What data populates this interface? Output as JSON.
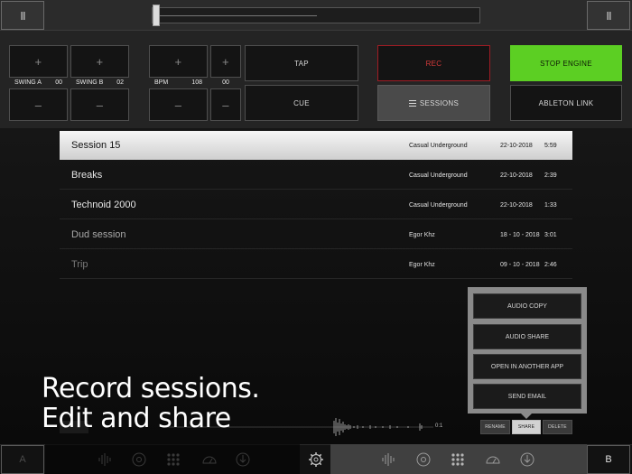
{
  "topbar": {
    "left_button": "II",
    "right_button": "II"
  },
  "controls": {
    "plus": "+",
    "minus": "–",
    "swing_a": {
      "label": "SWING A",
      "value": "00"
    },
    "swing_b": {
      "label": "SWING B",
      "value": "02"
    },
    "bpm": {
      "label": "BPM",
      "value": "108"
    },
    "bpm_fine": {
      "value": "00"
    },
    "tap": "TAP",
    "cue": "CUE",
    "rec": "REC",
    "sessions": "SESSIONS",
    "stop_engine": "STOP ENGINE",
    "ableton_link": "ABLETON LINK"
  },
  "sessions": [
    {
      "name": "Session 15",
      "artist": "Casual Underground",
      "date": "22-10-2018",
      "duration": "5:59"
    },
    {
      "name": "Breaks",
      "artist": "Casual Underground",
      "date": "22-10-2018",
      "duration": "2:39"
    },
    {
      "name": "Technoid 2000",
      "artist": "Casual Underground",
      "date": "22-10-2018",
      "duration": "1:33"
    },
    {
      "name": "Dud session",
      "artist": "Egor Khz",
      "date": "18 - 10 - 2018",
      "duration": "3:01"
    },
    {
      "name": "Trip",
      "artist": "Egor Khz",
      "date": "09 - 10 - 2018",
      "duration": "2:46"
    }
  ],
  "share_menu": {
    "audio_copy": "AUDIO COPY",
    "audio_share": "AUDIO SHARE",
    "open_in_app": "OPEN IN ANOTHER APP",
    "send_email": "SEND EMAIL"
  },
  "actions": {
    "rename": "RENAME",
    "share": "SHARE",
    "delete": "DELETE"
  },
  "waveform": {
    "ratio": "0:1"
  },
  "headline": {
    "line1": "Record sessions.",
    "line2": "Edit and share"
  },
  "bottombar": {
    "deck_a": "A",
    "deck_b": "B"
  },
  "colors": {
    "accent_green": "#5ccf23",
    "rec_red": "#d83a3a",
    "selected_row": "#ececec"
  }
}
